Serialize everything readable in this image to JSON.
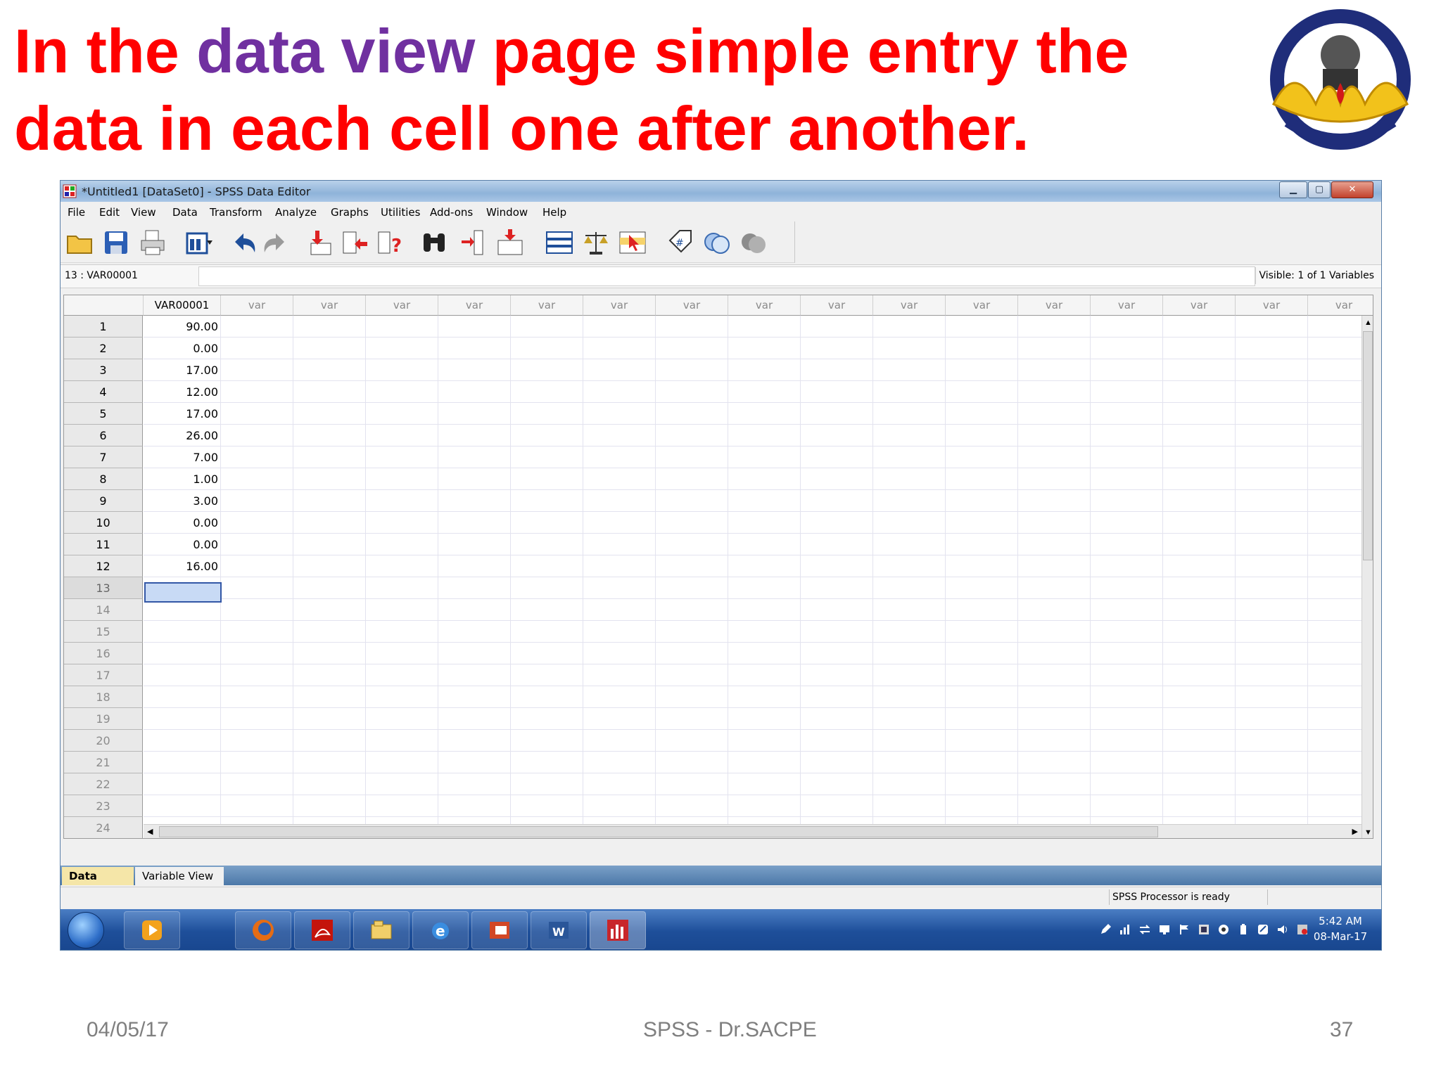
{
  "slide": {
    "title_red_1": "In the",
    "title_purple": "data view",
    "title_red_2": "page simple entry the data in each cell one after another.",
    "footer_date": "04/05/17",
    "footer_center": "SPSS - Dr.SACPE",
    "footer_page": "37"
  },
  "window": {
    "title": "*Untitled1 [DataSet0] - SPSS Data Editor",
    "min_label": "▁",
    "max_label": "▢",
    "close_label": "✕"
  },
  "menu": [
    {
      "label": "File"
    },
    {
      "label": "Edit"
    },
    {
      "label": "View"
    },
    {
      "label": "Data"
    },
    {
      "label": "Transform"
    },
    {
      "label": "Analyze"
    },
    {
      "label": "Graphs"
    },
    {
      "label": "Utilities"
    },
    {
      "label": "Add-ons"
    },
    {
      "label": "Window"
    },
    {
      "label": "Help"
    }
  ],
  "toolbar": [
    "open-folder-icon",
    "save-icon",
    "print-icon",
    "dialog-recall-icon",
    "undo-icon",
    "redo-icon",
    "goto-case-icon",
    "goto-variable-icon",
    "variables-info-icon",
    "find-icon",
    "insert-variable-icon",
    "insert-case-icon",
    "split-file-icon",
    "weight-cases-icon",
    "select-cases-icon",
    "value-labels-icon",
    "use-sets-icon",
    "show-all-variables-icon"
  ],
  "cellbar": {
    "cell_ref": "13 : VAR00001",
    "edit_value": "",
    "visible": "Visible: 1 of 1 Variables"
  },
  "grid": {
    "columns": [
      "VAR00001",
      "var",
      "var",
      "var",
      "var",
      "var",
      "var",
      "var",
      "var",
      "var",
      "var",
      "var",
      "var",
      "var",
      "var",
      "var",
      "var"
    ],
    "rows": [
      "1",
      "2",
      "3",
      "4",
      "5",
      "6",
      "7",
      "8",
      "9",
      "10",
      "11",
      "12",
      "13",
      "14",
      "15",
      "16",
      "17",
      "18",
      "19",
      "20",
      "21",
      "22",
      "23",
      "24"
    ],
    "values": [
      "90.00",
      "0.00",
      "17.00",
      "12.00",
      "17.00",
      "26.00",
      "7.00",
      "1.00",
      "3.00",
      "0.00",
      "0.00",
      "16.00"
    ],
    "selected_row": "13"
  },
  "tabs": {
    "data_view": "Data View",
    "variable_view": "Variable View"
  },
  "status": "SPSS  Processor is ready",
  "taskbar": {
    "apps": [
      "media-player-icon",
      "firefox-icon",
      "acrobat-icon",
      "explorer-icon",
      "internet-explorer-icon",
      "powerpoint-icon",
      "word-icon",
      "spss-icon"
    ],
    "time": "5:42 AM",
    "date": "08-Mar-17"
  },
  "colors": {
    "title_red": "#ff0000",
    "title_purple": "#7030a0",
    "selection": "#c8daf5",
    "active_tab": "#f5e6a8"
  }
}
